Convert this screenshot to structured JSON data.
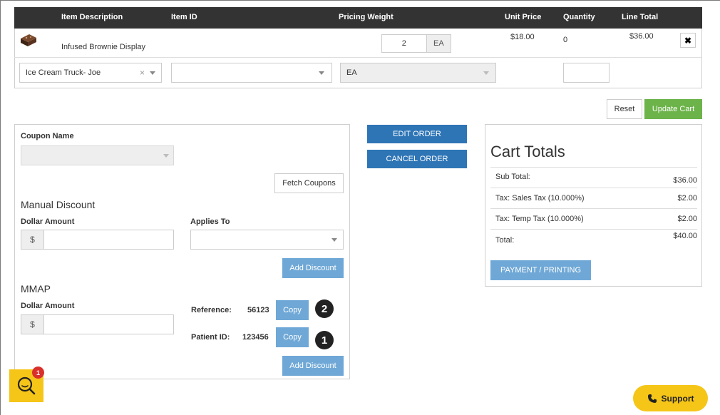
{
  "table": {
    "headers": {
      "item_description": "Item Description",
      "item_id": "Item ID",
      "pricing_weight": "Pricing Weight",
      "unit_price": "Unit Price",
      "quantity": "Quantity",
      "line_total": "Line Total"
    },
    "row": {
      "description": "Infused Brownie Display",
      "weight_value": "2",
      "weight_unit": "EA",
      "unit_price": "$18.00",
      "quantity": "0",
      "line_total": "$36.00",
      "remove_label": "✖"
    },
    "new_row": {
      "customer": "Ice Cream Truck- Joe",
      "clear": "×",
      "item_id": "",
      "uom": "EA",
      "quantity": ""
    }
  },
  "actions": {
    "reset": "Reset",
    "update_cart": "Update Cart"
  },
  "discount": {
    "coupon_label": "Coupon Name",
    "coupon_value": "",
    "fetch_coupons": "Fetch Coupons",
    "manual_title": "Manual Discount",
    "dollar_amount_label": "Dollar Amount",
    "currency_symbol": "$",
    "applies_to_label": "Applies To",
    "add_discount": "Add Discount",
    "mmap_title": "MMAP",
    "mmap_dollar_label": "Dollar Amount",
    "reference_label": "Reference:",
    "reference_value": "56123",
    "patient_label": "Patient ID:",
    "patient_value": "123456",
    "copy": "Copy",
    "badge_reference": "2",
    "badge_patient": "1"
  },
  "order": {
    "edit": "EDIT ORDER",
    "cancel": "CANCEL ORDER"
  },
  "totals": {
    "title": "Cart Totals",
    "rows": [
      {
        "label": "Sub Total:",
        "value": "$36.00"
      },
      {
        "label": "Tax: Sales Tax (10.000%)",
        "value": "$2.00"
      },
      {
        "label": "Tax: Temp Tax (10.000%)",
        "value": "$2.00"
      },
      {
        "label": "Total:",
        "value": "$40.00"
      }
    ],
    "payment": "PAYMENT / PRINTING"
  },
  "floating": {
    "chat_badge": "1",
    "support": "Support"
  },
  "colors": {
    "header_bg": "#333333",
    "green": "#6cb34a",
    "navy": "#2e75b6",
    "light_blue": "#6fa8d6",
    "yellow": "#f5c518"
  },
  "icons": {
    "product": "brownie-product-icon",
    "remove": "close-icon",
    "chat": "search-chat-icon",
    "support": "phone-icon"
  }
}
